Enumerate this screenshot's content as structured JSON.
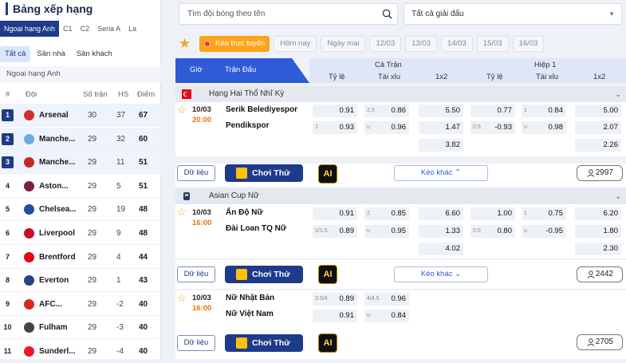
{
  "standings": {
    "title": "Bảng xếp hạng",
    "league_tabs": [
      "Ngoại hạng Anh",
      "C1",
      "C2",
      "Seria A",
      "La"
    ],
    "filter_tabs": [
      "Tất cả",
      "Sân nhà",
      "Sân khách"
    ],
    "league_name": "Ngoại hạng Anh",
    "headers": {
      "rank": "#",
      "team": "Đội",
      "played": "Số trận",
      "gd": "HS",
      "pts": "Điểm"
    },
    "rows": [
      {
        "rank": "1",
        "team": "Arsenal",
        "played": "30",
        "gd": "37",
        "pts": "67",
        "color": "#d32f2f"
      },
      {
        "rank": "2",
        "team": "Manche...",
        "played": "29",
        "gd": "32",
        "pts": "60",
        "color": "#6cabdd"
      },
      {
        "rank": "3",
        "team": "Manche...",
        "played": "29",
        "gd": "11",
        "pts": "51",
        "color": "#c62828"
      },
      {
        "rank": "4",
        "team": "Aston...",
        "played": "29",
        "gd": "5",
        "pts": "51",
        "color": "#7b1f3a"
      },
      {
        "rank": "5",
        "team": "Chelsea...",
        "played": "29",
        "gd": "19",
        "pts": "48",
        "color": "#1e4fa0"
      },
      {
        "rank": "6",
        "team": "Liverpool",
        "played": "29",
        "gd": "9",
        "pts": "48",
        "color": "#c8102e"
      },
      {
        "rank": "7",
        "team": "Brentford",
        "played": "29",
        "gd": "4",
        "pts": "44",
        "color": "#e30613"
      },
      {
        "rank": "8",
        "team": "Everton",
        "played": "29",
        "gd": "1",
        "pts": "43",
        "color": "#274488"
      },
      {
        "rank": "9",
        "team": "AFC...",
        "played": "29",
        "gd": "-2",
        "pts": "40",
        "color": "#da291c"
      },
      {
        "rank": "10",
        "team": "Fulham",
        "played": "29",
        "gd": "-3",
        "pts": "40",
        "color": "#444444"
      },
      {
        "rank": "11",
        "team": "Sunderl...",
        "played": "29",
        "gd": "-4",
        "pts": "40",
        "color": "#eb172b"
      }
    ]
  },
  "search": {
    "placeholder": "Tìm đội bóng theo tên"
  },
  "league_select": {
    "value": "Tất cả giải đấu"
  },
  "dates": {
    "live": "Kèo trực tuyến",
    "items": [
      "Hôm nay",
      "Ngày mai",
      "12/03",
      "13/03",
      "14/03",
      "15/03",
      "16/03"
    ]
  },
  "grid": {
    "col_time": "Giờ",
    "col_match": "Trận Đấu",
    "full": "Cả Trận",
    "half": "Hiệp 1",
    "handicap": "Tỷ lệ",
    "ou": "Tài xỉu",
    "x12": "1x2"
  },
  "buttons": {
    "data": "Dữ liệu",
    "play": "Chơi Thử",
    "ai": "AI",
    "more": "Kèo khác"
  },
  "leagues": [
    {
      "name": "Hạng Hai Thổ Nhĩ Kỳ",
      "matches": [
        {
          "date": "10/03",
          "time": "20:00",
          "home": "Serik Belediyespor",
          "away": "Pendikspor",
          "ft_hdp_tag2": "1",
          "ft_hdp": [
            "0.91",
            "0.93"
          ],
          "ft_ou_tag1": "2.5",
          "ft_ou_tag2": "u",
          "ft_ou": [
            "0.86",
            "0.96"
          ],
          "ft_1x2": [
            "5.50",
            "1.47",
            "3.82"
          ],
          "h1_hdp_tag2": "0.5",
          "h1_hdp": [
            "0.77",
            "-0.93"
          ],
          "h1_ou_tag1": "1",
          "h1_ou_tag2": "u",
          "h1_ou": [
            "0.84",
            "0.98"
          ],
          "h1_1x2": [
            "5.00",
            "2.07",
            "2.26"
          ],
          "count": "2997"
        }
      ]
    },
    {
      "name": "Asian Cup Nữ",
      "matches": [
        {
          "date": "10/03",
          "time": "16:00",
          "home": "Ấn Độ Nữ",
          "away": "Đài Loan TQ Nữ",
          "ft_hdp_tag2": "1/1.5",
          "ft_hdp": [
            "0.91",
            "0.89"
          ],
          "ft_ou_tag1": "2",
          "ft_ou_tag2": "u",
          "ft_ou": [
            "0.85",
            "0.95"
          ],
          "ft_1x2": [
            "6.60",
            "1.33",
            "4.02"
          ],
          "h1_hdp_tag2": "0.5",
          "h1_hdp": [
            "1.00",
            "0.80"
          ],
          "h1_ou_tag1": "1",
          "h1_ou_tag2": "u",
          "h1_ou": [
            "0.75",
            "-0.95"
          ],
          "h1_1x2": [
            "6.20",
            "1.80",
            "2.30"
          ],
          "count": "2442"
        },
        {
          "date": "10/03",
          "time": "16:00",
          "home": "Nữ Nhật Bản",
          "away": "Nữ Việt Nam",
          "ft_hdp_tag1": "3.5/4",
          "ft_hdp": [
            "0.89",
            "0.91"
          ],
          "ft_ou_tag1": "4/4.5",
          "ft_ou_tag2": "u",
          "ft_ou": [
            "0.96",
            "0.84"
          ],
          "count": "2705"
        }
      ]
    }
  ]
}
